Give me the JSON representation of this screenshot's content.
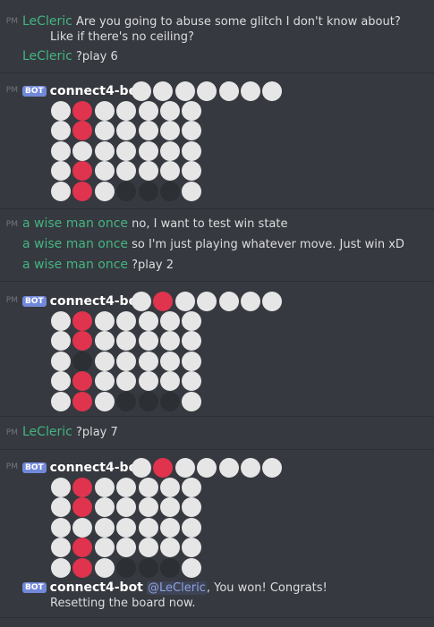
{
  "timestamp_suffix": "PM",
  "bot_tag": "BOT",
  "messages": [
    {
      "author": "LeCleric",
      "lines": [
        "Are you going to abuse some glitch I don't know about?",
        "Like if there's no ceiling?"
      ]
    },
    {
      "author": "LeCleric",
      "lines": [
        "?play 6"
      ]
    },
    {
      "author": "connect4-bot",
      "bot": true,
      "header": [
        "w",
        "w",
        "w",
        "w",
        "w",
        "w",
        "w"
      ],
      "board": [
        [
          "w",
          "r",
          "w",
          "w",
          "w",
          "w",
          "w"
        ],
        [
          "w",
          "r",
          "w",
          "w",
          "w",
          "w",
          "w"
        ],
        [
          "w",
          "w",
          "w",
          "w",
          "w",
          "w",
          "w"
        ],
        [
          "w",
          "r",
          "w",
          "w",
          "w",
          "w",
          "w"
        ],
        [
          "w",
          "r",
          "w",
          "e",
          "e",
          "e",
          "w"
        ]
      ]
    },
    {
      "author": "a wise man once",
      "lines": [
        "no, I want to test win state"
      ]
    },
    {
      "author": "a wise man once",
      "lines": [
        "so I'm just playing whatever move. Just win xD"
      ]
    },
    {
      "author": "a wise man once",
      "lines": [
        "?play 2"
      ]
    },
    {
      "author": "connect4-bot",
      "bot": true,
      "header": [
        "w",
        "r",
        "w",
        "w",
        "w",
        "w",
        "w"
      ],
      "board": [
        [
          "w",
          "r",
          "w",
          "w",
          "w",
          "w",
          "w"
        ],
        [
          "w",
          "r",
          "w",
          "w",
          "w",
          "w",
          "w"
        ],
        [
          "w",
          "e",
          "w",
          "w",
          "w",
          "w",
          "w"
        ],
        [
          "w",
          "r",
          "w",
          "w",
          "w",
          "w",
          "w"
        ],
        [
          "w",
          "r",
          "w",
          "e",
          "e",
          "e",
          "w"
        ]
      ]
    },
    {
      "author": "LeCleric",
      "lines": [
        "?play 7"
      ]
    },
    {
      "author": "connect4-bot",
      "bot": true,
      "header": [
        "w",
        "r",
        "w",
        "w",
        "w",
        "w",
        "w"
      ],
      "board": [
        [
          "w",
          "r",
          "w",
          "w",
          "w",
          "w",
          "w"
        ],
        [
          "w",
          "r",
          "w",
          "w",
          "w",
          "w",
          "w"
        ],
        [
          "w",
          "w",
          "w",
          "w",
          "w",
          "w",
          "w"
        ],
        [
          "w",
          "r",
          "w",
          "w",
          "w",
          "w",
          "w"
        ],
        [
          "w",
          "r",
          "w",
          "e",
          "e",
          "e",
          "w"
        ]
      ]
    },
    {
      "author": "connect4-bot",
      "bot": true,
      "mention": "@LeCleric",
      "lines": [
        ", You won! Congrats!",
        "Resetting the board now."
      ]
    }
  ]
}
